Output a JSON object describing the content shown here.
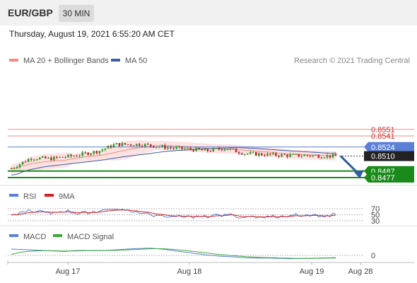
{
  "header": {
    "symbol": "EUR/GBP",
    "timeframe": "30 MIN"
  },
  "datetime": "Thursday, August 19, 2021 6:55:20 AM CET",
  "legend": {
    "items": [
      {
        "label": "MA 20 + Bollinger Bands",
        "color": "#f28b82"
      },
      {
        "label": "MA 50",
        "color": "#3a5ea8"
      }
    ],
    "credit": "Research © 2021 Trading Central"
  },
  "colors": {
    "up_candle": "#2e9e2e",
    "down_candle": "#b03030",
    "bollinger_fill": "#fde2e2",
    "ma20": "#f28b82",
    "ma50": "#3a5ea8",
    "resistance": "#f28b82",
    "pivot": "#5b7fd6",
    "support": "#1a8a1a",
    "current_price_bg": "#222222",
    "arrow": "#2f5d9e",
    "rsi": "#5b7fd6",
    "rsi_ma": "#d62020",
    "macd": "#5b7fd6",
    "macd_signal": "#3aa83a"
  },
  "chart_data": [
    {
      "type": "line",
      "name": "price",
      "x_ticks": [
        "Aug 17",
        "Aug 18",
        "Aug 19",
        "Aug 28"
      ],
      "ylim": [
        0.847,
        0.856
      ],
      "levels": [
        {
          "value": 0.8551,
          "label": "0.8551",
          "kind": "resistance"
        },
        {
          "value": 0.8541,
          "label": "0.8541",
          "kind": "resistance"
        },
        {
          "value": 0.8524,
          "label": "0.8524",
          "kind": "pivot"
        },
        {
          "value": 0.851,
          "label": "0.8510",
          "kind": "current"
        },
        {
          "value": 0.8487,
          "label": "0.8487",
          "kind": "support"
        },
        {
          "value": 0.8477,
          "label": "0.8477",
          "kind": "support"
        }
      ],
      "forecast": {
        "from": 0.851,
        "to": 0.848
      }
    },
    {
      "type": "line",
      "name": "RSI",
      "series": [
        {
          "name": "RSI"
        },
        {
          "name": "9MA"
        }
      ],
      "levels": [
        70,
        50,
        30
      ],
      "ylim": [
        20,
        80
      ]
    },
    {
      "type": "line",
      "name": "MACD",
      "series": [
        {
          "name": "MACD"
        },
        {
          "name": "MACD Signal"
        }
      ],
      "zero_label": "0"
    }
  ]
}
